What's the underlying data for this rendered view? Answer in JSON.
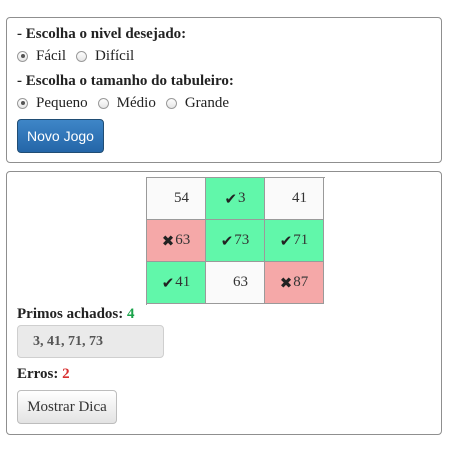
{
  "settings": {
    "level_heading": "- Escolha o nivel desejado:",
    "levels": [
      {
        "label": "Fácil",
        "checked": true
      },
      {
        "label": "Difícil",
        "checked": false
      }
    ],
    "size_heading": "- Escolha o tamanho do tabuleiro:",
    "sizes": [
      {
        "label": "Pequeno",
        "checked": true
      },
      {
        "label": "Médio",
        "checked": false
      },
      {
        "label": "Grande",
        "checked": false
      }
    ],
    "new_game_label": "Novo Jogo"
  },
  "board": {
    "cells": [
      {
        "value": "54",
        "state": "plain"
      },
      {
        "value": "3",
        "state": "correct"
      },
      {
        "value": "41",
        "state": "plain"
      },
      {
        "value": "63",
        "state": "wrong"
      },
      {
        "value": "73",
        "state": "correct"
      },
      {
        "value": "71",
        "state": "correct"
      },
      {
        "value": "41",
        "state": "correct"
      },
      {
        "value": "63",
        "state": "plain"
      },
      {
        "value": "87",
        "state": "wrong"
      }
    ],
    "correct_symbol": "✔",
    "wrong_symbol": "✖",
    "colors": {
      "correct": "#61f7aa",
      "wrong": "#f5a8a8",
      "plain": "#fafafa"
    }
  },
  "results": {
    "found_label": "Primos achados:",
    "found_count": "4",
    "found_list": "3, 41, 71, 73",
    "errors_label": "Erros:",
    "errors_count": "2",
    "hint_label": "Mostrar Dica"
  }
}
